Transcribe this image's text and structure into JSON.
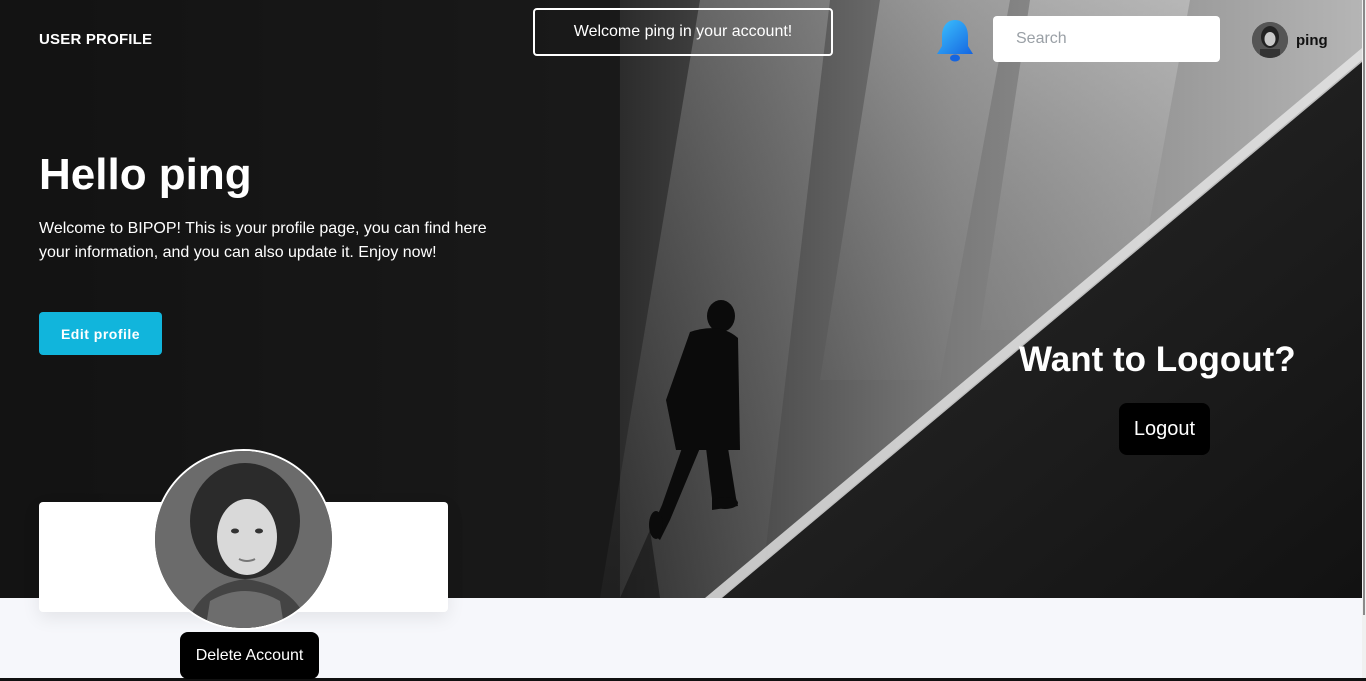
{
  "header": {
    "brand": "USER PROFILE",
    "welcome_message": "Welcome ping in your account!",
    "search_placeholder": "Search",
    "user_name": "ping",
    "bell_color": "#1e90ff"
  },
  "hero": {
    "greeting": "Hello ping",
    "intro": "Welcome to BIPOP! This is your profile page, you can find here your information, and you can also update it. Enjoy now!",
    "edit_button": "Edit profile",
    "edit_button_color": "#11b5dc"
  },
  "logout": {
    "title": "Want to Logout?",
    "button": "Logout"
  },
  "profile_card": {
    "delete_button": "Delete Account"
  },
  "icons": [
    "bell-icon"
  ]
}
